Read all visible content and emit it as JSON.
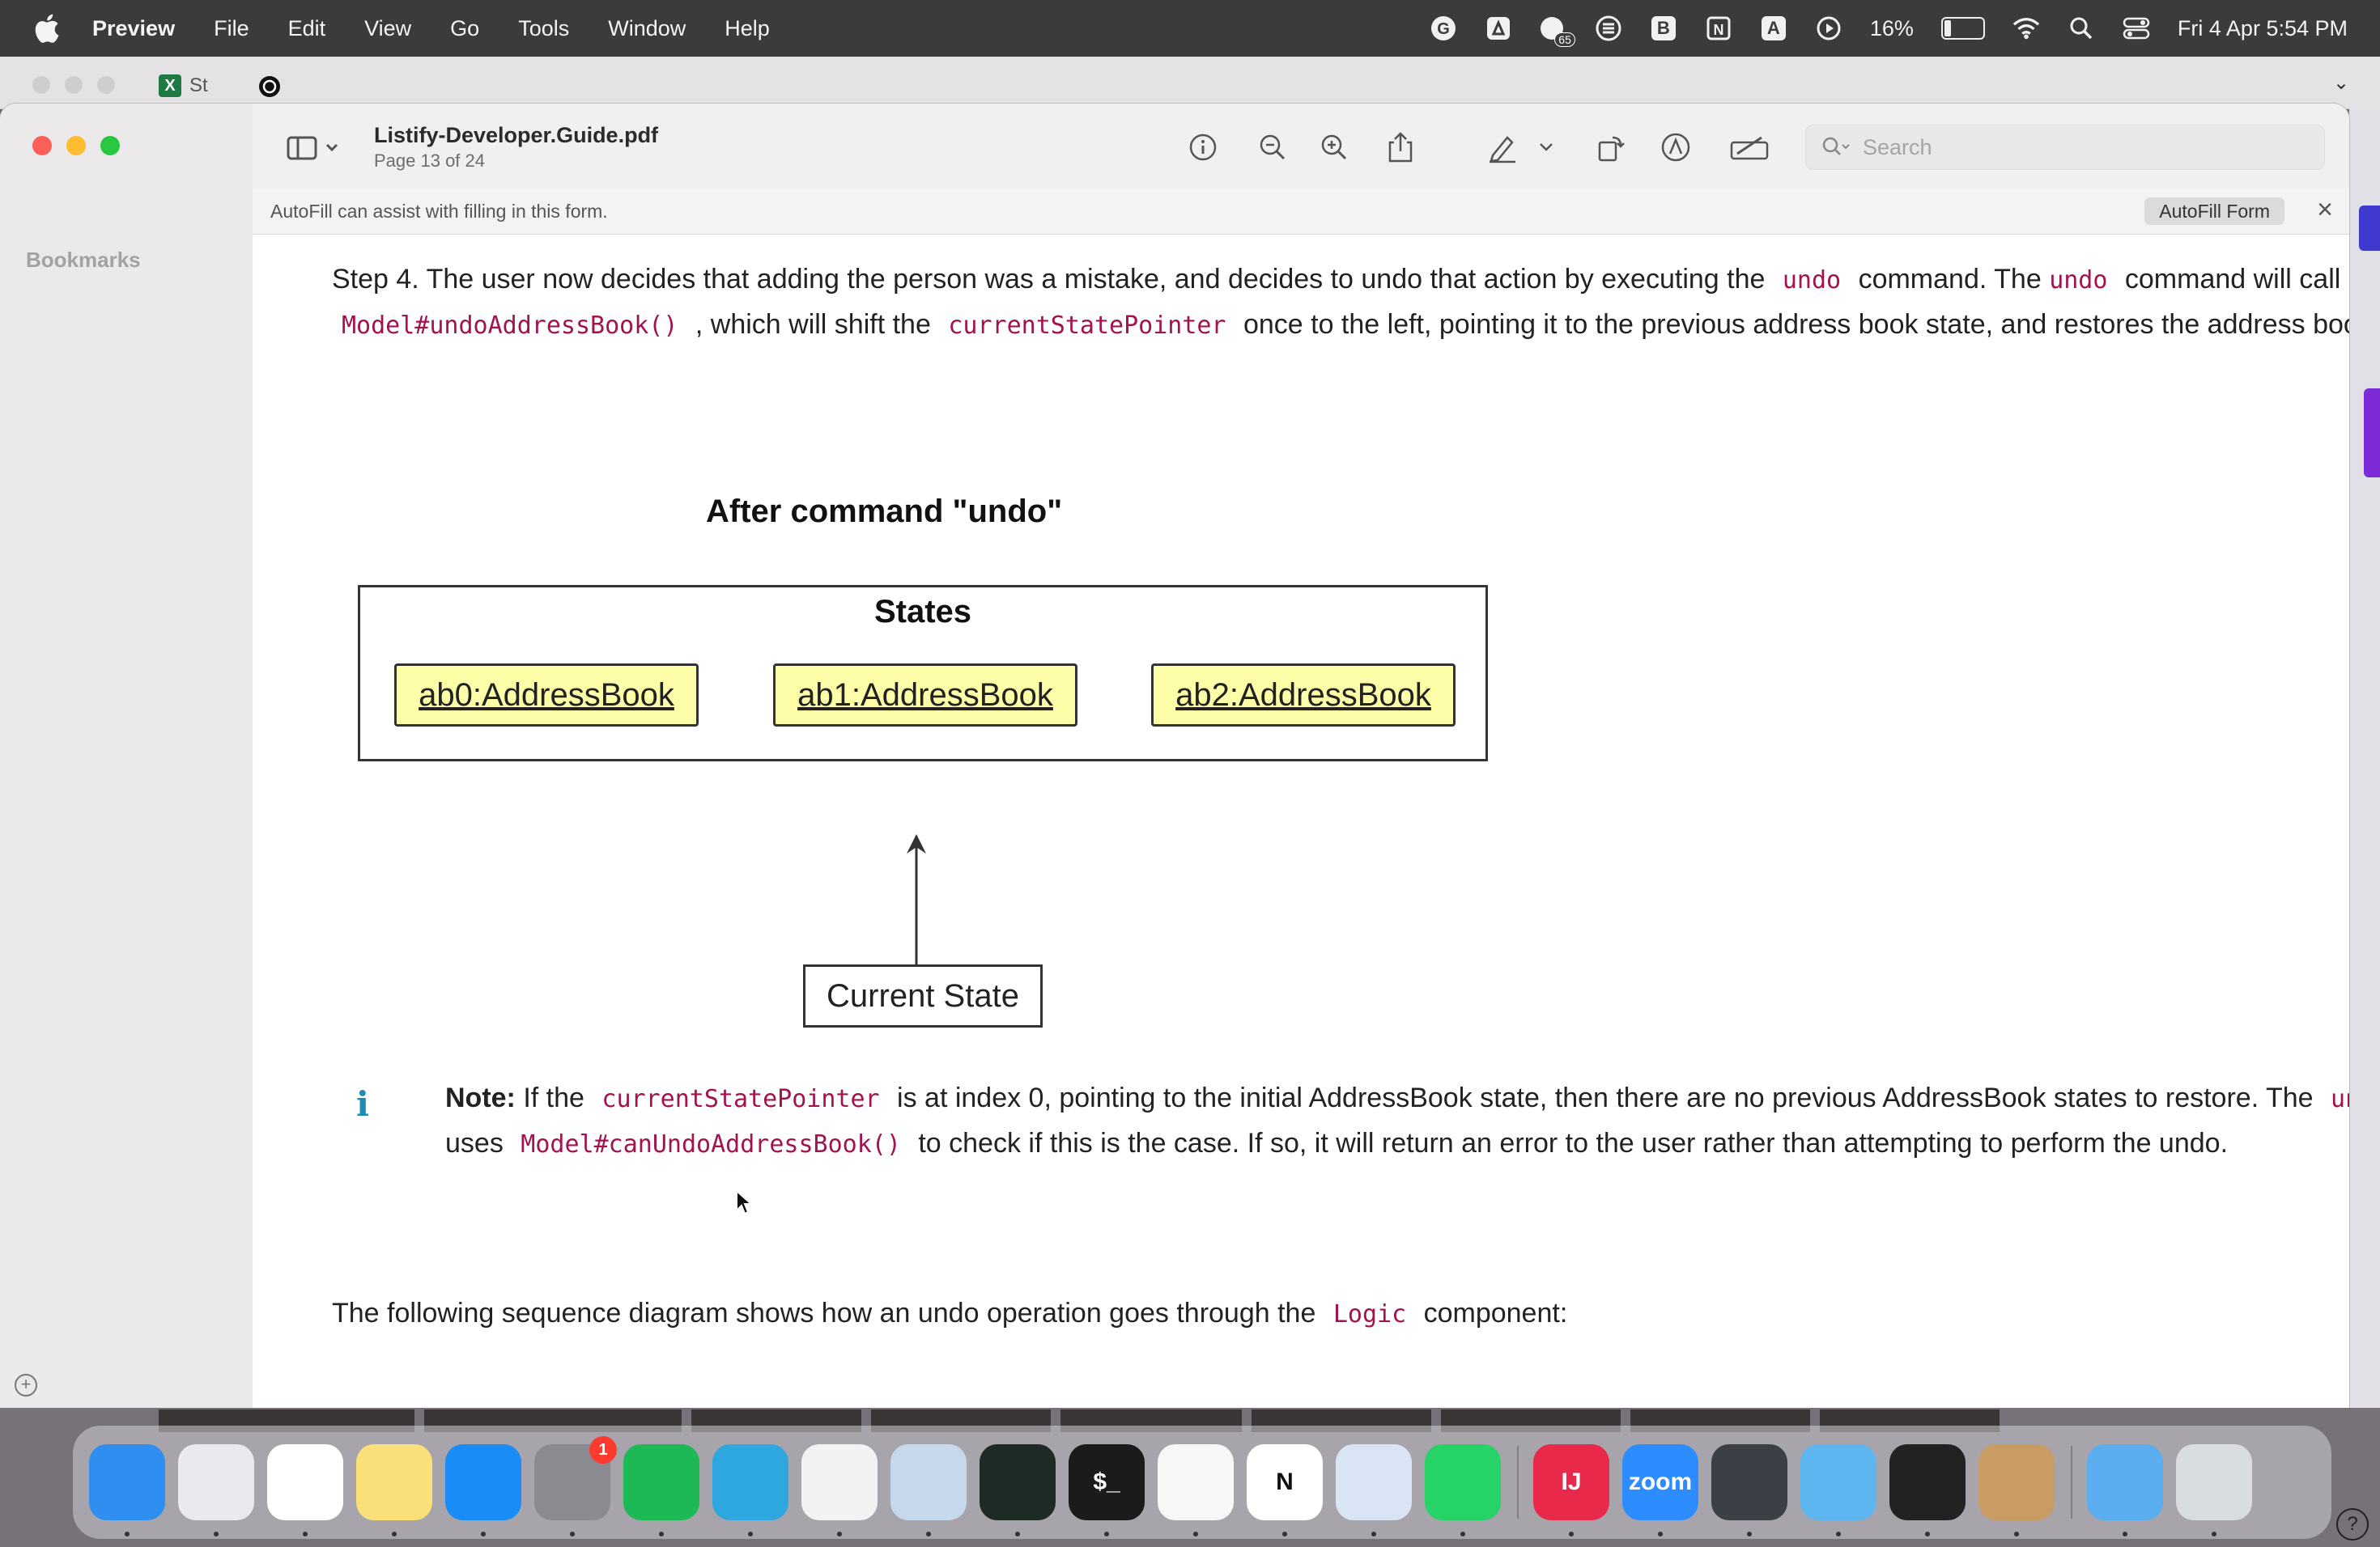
{
  "menubar": {
    "app_name": "Preview",
    "items": [
      "File",
      "Edit",
      "View",
      "Go",
      "Tools",
      "Window",
      "Help"
    ],
    "battery_percent": "16%",
    "clock": "Fri 4 Apr  5:54 PM",
    "tray_badge": "65"
  },
  "background_window": {
    "tab_label": "St"
  },
  "window": {
    "doc_title": "Listify-Developer.Guide.pdf",
    "doc_page": "Page 13 of 24",
    "search_placeholder": "Search",
    "autofill_message": "AutoFill can assist with filling in this form.",
    "autofill_button": "AutoFill Form"
  },
  "sidebar": {
    "bookmarks_label": "Bookmarks"
  },
  "content": {
    "step4": {
      "t1": "Step 4. The user now decides that adding the person was a mistake, and decides to undo that action by executing the",
      "c1": "undo",
      "t2": "command. The",
      "c2": "undo",
      "t3": "command will call",
      "c3": "Model#undoAddressBook()",
      "t4": ", which will shift the",
      "c4": "currentStatePointer",
      "t5": "once to the left, pointing it to the previous address book state, and restores the address book to that state."
    },
    "diagram": {
      "title": "After command \"undo\"",
      "frame_label": "States",
      "states": [
        "ab0:AddressBook",
        "ab1:AddressBook",
        "ab2:AddressBook"
      ],
      "pointer_label": "Current State"
    },
    "note": {
      "label": "Note:",
      "t1": "If the",
      "c1": "currentStatePointer",
      "t2": "is at index 0, pointing to the initial AddressBook state, then there are no previous AddressBook states to restore. The",
      "c2": "undo",
      "t3": "command uses",
      "c3": "Model#canUndoAddressBook()",
      "t4": "to check if this is the case. If so, it will return an error to the user rather than attempting to perform the undo."
    },
    "sequence_intro": {
      "t1": "The following sequence diagram shows how an undo operation goes through the",
      "c1": "Logic",
      "t2": "component:"
    }
  },
  "dock": {
    "apps": [
      {
        "name": "Finder",
        "color": "#2f8ff0",
        "label": ""
      },
      {
        "name": "Launchpad",
        "color": "#e9e9ee",
        "label": ""
      },
      {
        "name": "Photos",
        "color": "#ffffff",
        "label": ""
      },
      {
        "name": "Notes",
        "color": "#fbe07a",
        "label": ""
      },
      {
        "name": "App Store",
        "color": "#1a8cf7",
        "label": ""
      },
      {
        "name": "System Settings",
        "color": "#8a8a90",
        "label": "",
        "badge": "1"
      },
      {
        "name": "Spotify",
        "color": "#1db954",
        "label": ""
      },
      {
        "name": "Telegram",
        "color": "#2ea6e0",
        "label": ""
      },
      {
        "name": "Chrome",
        "color": "#f2f2f2",
        "label": ""
      },
      {
        "name": "Preview",
        "color": "#c6d9ec",
        "label": ""
      },
      {
        "name": "Activity Monitor",
        "color": "#1e2b24",
        "label": ""
      },
      {
        "name": "Terminal",
        "color": "#1b1b1b",
        "label": "$_"
      },
      {
        "name": "Google Drive",
        "color": "#f7f7f7",
        "label": ""
      },
      {
        "name": "Notion",
        "color": "#ffffff",
        "label": "N"
      },
      {
        "name": "iPhone Mirroring",
        "color": "#d9e4f4",
        "label": ""
      },
      {
        "name": "WhatsApp",
        "color": "#25d366",
        "label": ""
      },
      {
        "name": "IntelliJ IDEA",
        "color": "#e8294a",
        "label": "IJ"
      },
      {
        "name": "Zoom",
        "color": "#2d8cff",
        "label": "zoom"
      },
      {
        "name": "QuickTime",
        "color": "#3b4047",
        "label": ""
      },
      {
        "name": "Files",
        "color": "#5eb6f0",
        "label": ""
      },
      {
        "name": "Unity Hub",
        "color": "#222222",
        "label": ""
      },
      {
        "name": "Contacts",
        "color": "#c89c63",
        "label": ""
      },
      {
        "name": "Downloads",
        "color": "#5aaef0",
        "label": ""
      },
      {
        "name": "Trash",
        "color": "#d8dde2",
        "label": ""
      }
    ]
  },
  "help_label": "?"
}
